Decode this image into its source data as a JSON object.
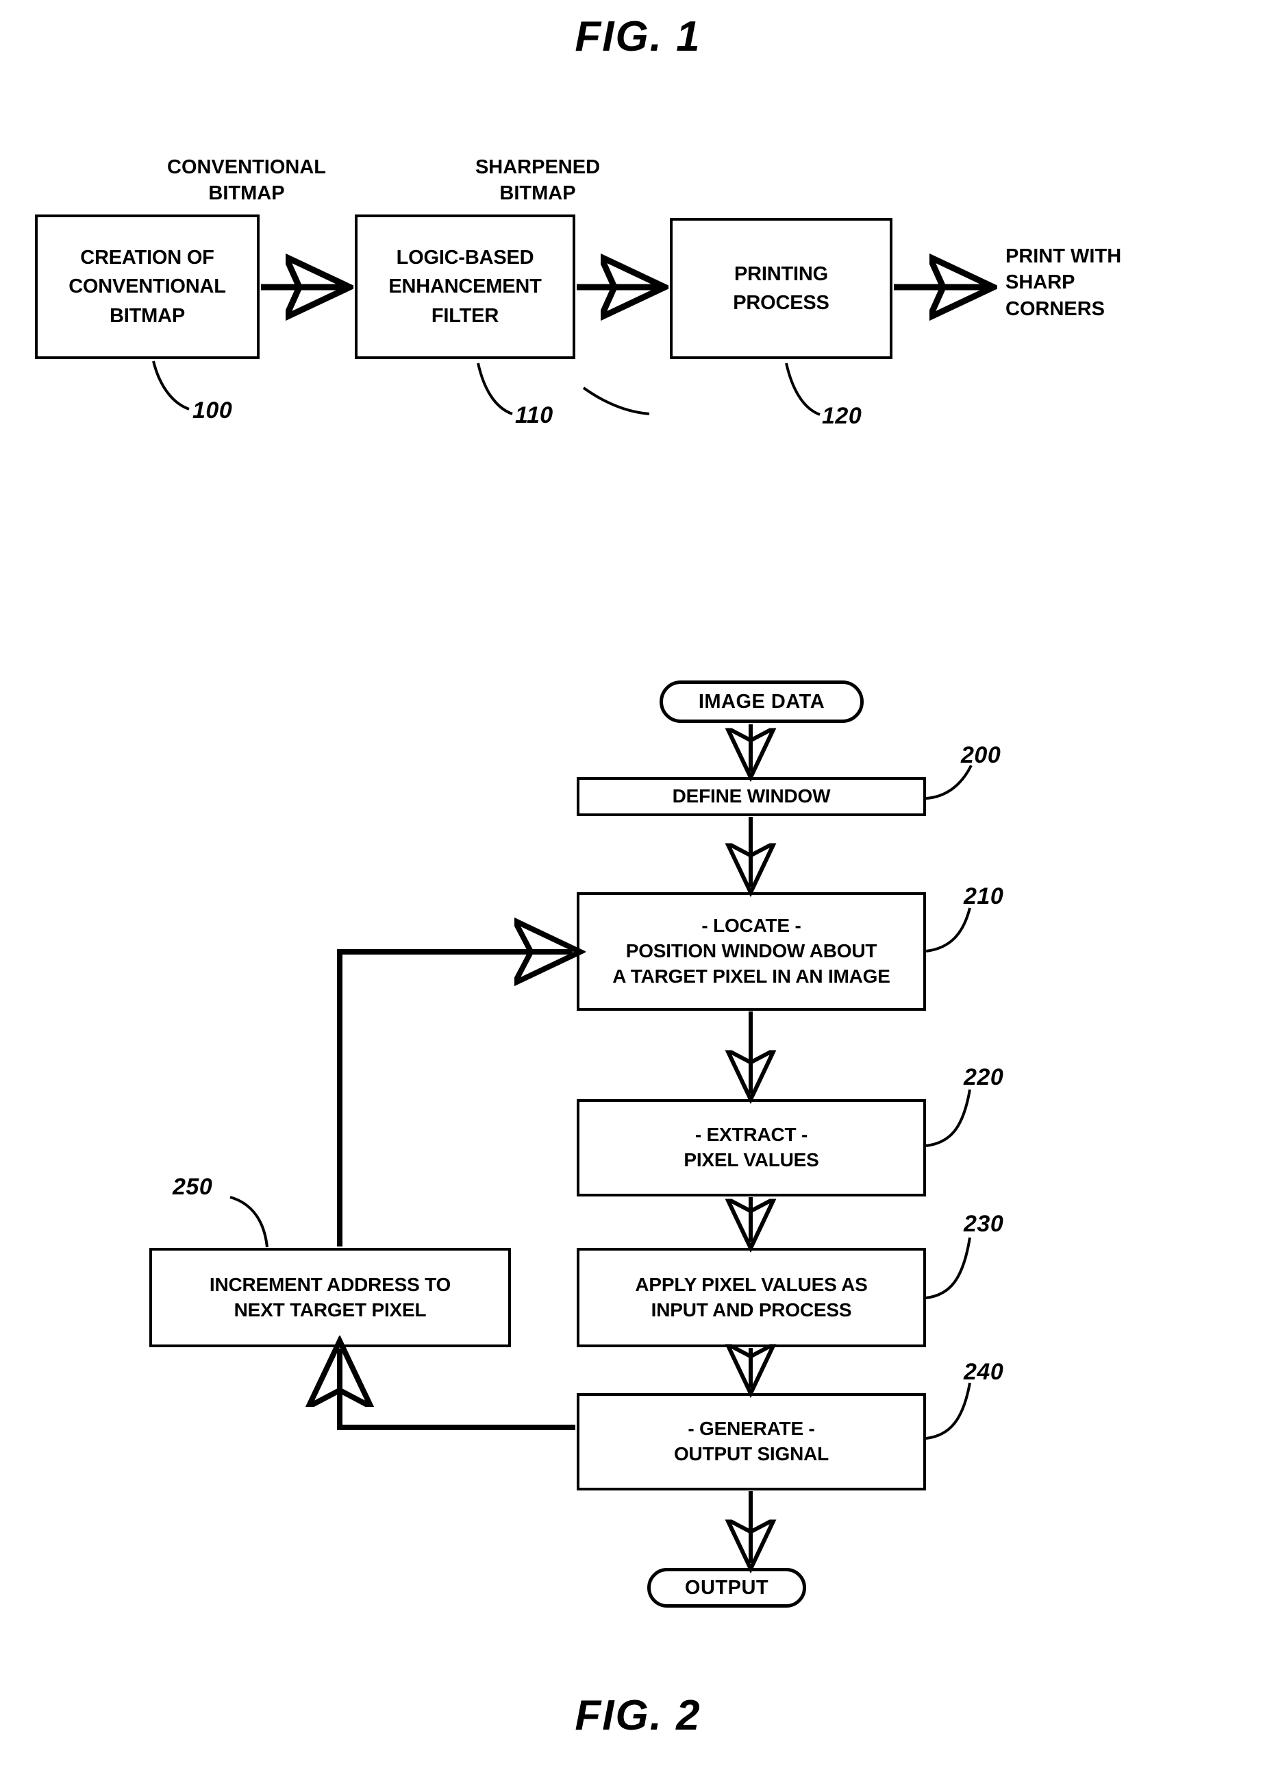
{
  "figures": [
    {
      "id": "fig1",
      "title": "FIG. 1",
      "flow_labels": {
        "conventional_bitmap_line1": "CONVENTIONAL",
        "conventional_bitmap_line2": "BITMAP",
        "sharpened_bitmap_line1": "SHARPENED",
        "sharpened_bitmap_line2": "BITMAP",
        "output_line1": "PRINT WITH",
        "output_line2": "SHARP",
        "output_line3": "CORNERS"
      },
      "boxes": [
        {
          "ref": "100",
          "lines": [
            "CREATION OF",
            "CONVENTIONAL",
            "BITMAP"
          ]
        },
        {
          "ref": "110",
          "lines": [
            "LOGIC-BASED",
            "ENHANCEMENT",
            "FILTER"
          ]
        },
        {
          "ref": "120",
          "lines": [
            "PRINTING",
            "PROCESS"
          ]
        }
      ]
    },
    {
      "id": "fig2",
      "title": "FIG. 2",
      "start_terminator": "IMAGE DATA",
      "end_terminator": "OUTPUT",
      "boxes": [
        {
          "ref": "200",
          "lines": [
            "DEFINE WINDOW"
          ]
        },
        {
          "ref": "210",
          "lines": [
            "- LOCATE -",
            "POSITION WINDOW ABOUT",
            "A TARGET PIXEL IN AN IMAGE"
          ]
        },
        {
          "ref": "220",
          "lines": [
            "- EXTRACT -",
            "PIXEL VALUES"
          ]
        },
        {
          "ref": "230",
          "lines": [
            "APPLY PIXEL VALUES AS",
            "INPUT AND PROCESS"
          ]
        },
        {
          "ref": "240",
          "lines": [
            "- GENERATE -",
            "OUTPUT SIGNAL"
          ]
        },
        {
          "ref": "250",
          "lines": [
            "INCREMENT ADDRESS TO",
            "NEXT TARGET PIXEL"
          ]
        }
      ]
    }
  ],
  "colors": {
    "ink": "#000000",
    "paper": "#ffffff"
  }
}
